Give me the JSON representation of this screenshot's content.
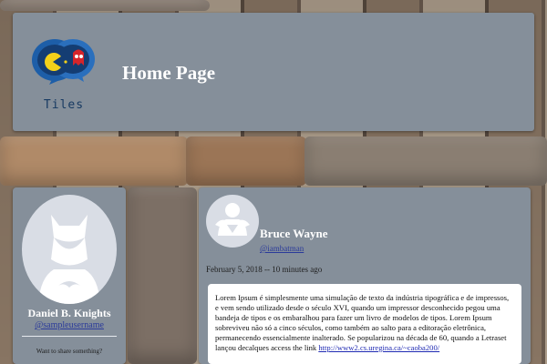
{
  "header": {
    "logo_text": "Tiles",
    "title": "Home Page"
  },
  "profile": {
    "name": "Daniel B. Knights",
    "username": "@sampleusername",
    "share_prompt": "Want to share something?"
  },
  "post": {
    "author": "Bruce Wayne",
    "handle": "@iambatman",
    "timestamp": "February 5, 2018 -- 10 minutes ago",
    "text_before_link": "Lorem Ipsum é simplesmente uma simulação de texto da indústria tipográfica e de impressos, e vem sendo utilizado desde o século XVI, quando um impressor desconhecido pegou uma bandeja de tipos e os embaralhou para fazer um livro de modelos de tipos. Lorem Ipsum sobreviveu não só a cinco séculos, como também ao salto para a editoração eletrônica, permanecendo essencialmente inalterado. Se popularizou na década de 60, quando a Letraset lançou decalques access the link ",
    "link": "http://www2.cs.uregina.ca/~caoba200/"
  },
  "colors": {
    "panel": "#858f9a",
    "link": "#2a3a9a",
    "logo_blue": "#173a62"
  },
  "icons": {
    "logo": "pacman-ghost-chat-logo",
    "profile_avatar": "batman-silhouette-avatar",
    "post_avatar": "superman-silhouette-avatar"
  }
}
